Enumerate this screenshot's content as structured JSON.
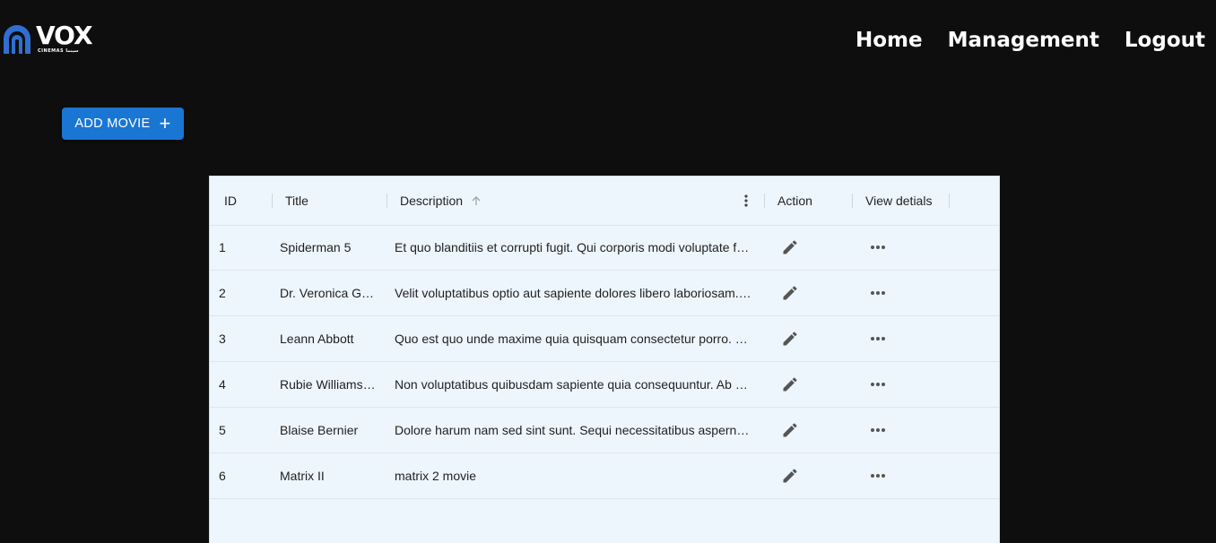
{
  "brand": {
    "name": "VOX",
    "subtitle": "CINEMAS سينما",
    "color": "#2f6fd1"
  },
  "nav": {
    "items": [
      "Home",
      "Management",
      "Logout"
    ]
  },
  "toolbar": {
    "add_label": "ADD MOVIE",
    "add_icon": "plus-icon",
    "accent": "#1976d2"
  },
  "table": {
    "columns": {
      "id": "ID",
      "title": "Title",
      "description": "Description",
      "action": "Action",
      "view": "View detials"
    },
    "sort": {
      "column": "description",
      "direction": "ascending",
      "icon": "arrow-up-icon"
    },
    "rows": [
      {
        "id": "1",
        "title": "Spiderman 5",
        "description": "Et quo blanditiis et corrupti fugit. Qui corporis modi voluptate f…"
      },
      {
        "id": "2",
        "title": "Dr. Veronica G…",
        "description": "Velit voluptatibus optio aut sapiente dolores libero laboriosam.…"
      },
      {
        "id": "3",
        "title": "Leann Abbott",
        "description": "Quo est quo unde maxime quia quisquam consectetur porro. …"
      },
      {
        "id": "4",
        "title": "Rubie Williams…",
        "description": "Non voluptatibus quibusdam sapiente quia consequuntur. Ab …"
      },
      {
        "id": "5",
        "title": "Blaise Bernier",
        "description": "Dolore harum nam sed sint sunt. Sequi necessitatibus aspern…"
      },
      {
        "id": "6",
        "title": "Matrix II",
        "description": "matrix 2 movie"
      }
    ],
    "row_icons": {
      "action": "pencil-edit-icon",
      "view": "more-horizontal-icon"
    }
  }
}
